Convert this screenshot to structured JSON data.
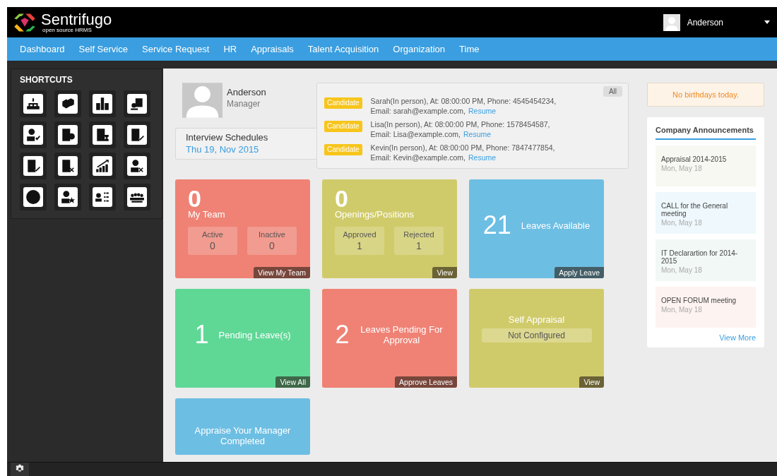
{
  "header": {
    "brand": "Sentrifugo",
    "tagline": "open source HRMS",
    "user": "Anderson"
  },
  "nav": [
    "Dashboard",
    "Self Service",
    "Service Request",
    "HR",
    "Appraisals",
    "Talent Acquisition",
    "Organization",
    "Time"
  ],
  "shortcuts": {
    "title": "SHORTCUTS"
  },
  "profile": {
    "name": "Anderson",
    "role": "Manager"
  },
  "interviews": {
    "title": "Interview Schedules",
    "date": "Thu 19, Nov 2015",
    "filter": "All",
    "items": [
      {
        "badge": "Candidate",
        "line1": "Sarah(In person),  At: 08:00:00 PM, Phone: 4545454234,",
        "email": "Email: sarah@example.com,",
        "link": "Resume"
      },
      {
        "badge": "Candidate",
        "line1": "Lisa(In person),  At: 08:00:00 PM, Phone: 1578454587,",
        "email": "Email: Lisa@example.com,",
        "link": "Resume"
      },
      {
        "badge": "Candidate",
        "line1": "Kevin(In person),  At: 08:00:00 PM, Phone: 7847477854,",
        "email": "Email: Kevin@example.com,",
        "link": "Resume"
      }
    ]
  },
  "tiles": [
    {
      "kind": "stats",
      "color": "#ef8275",
      "number": "0",
      "label": "My Team",
      "stats": [
        {
          "label": "Active",
          "value": "0"
        },
        {
          "label": "Inactive",
          "value": "0"
        }
      ],
      "action": "View My Team"
    },
    {
      "kind": "stats",
      "color": "#d0cb6a",
      "number": "0",
      "label": "Openings/Positions",
      "stats": [
        {
          "label": "Approved",
          "value": "1"
        },
        {
          "label": "Rejected",
          "value": "1"
        }
      ],
      "action": "View"
    },
    {
      "kind": "count",
      "color": "#6dbee3",
      "number": "21",
      "label": "Leaves Available",
      "action": "Apply Leave"
    },
    {
      "kind": "count",
      "color": "#5fd896",
      "number": "1",
      "label": "Pending Leave(s)",
      "action": "View All"
    },
    {
      "kind": "count",
      "color": "#ef8275",
      "number": "2",
      "label": "Leaves Pending For Approval",
      "action": "Approve Leaves"
    },
    {
      "kind": "status",
      "color": "#d0cb6a",
      "title": "Self Appraisal",
      "status": "Not Configured",
      "action": "View"
    },
    {
      "kind": "message",
      "color": "#6dbee3",
      "text": "Appraise Your Manager Completed"
    }
  ],
  "birthdays": "No birthdays today.",
  "announcements": {
    "title": "Company Announcements",
    "items": [
      {
        "title": "Appraisal 2014-2015",
        "date": "Mon, May 18",
        "color": "#f8f8f2"
      },
      {
        "title": "CALL for the General meeting",
        "date": "Mon, May 18",
        "color": "#eef8fd"
      },
      {
        "title": "IT Declarartion for 2014-2015",
        "date": "Mon, May 18",
        "color": "#f1f8f5"
      },
      {
        "title": "OPEN FORUM meeting",
        "date": "Mon, May 18",
        "color": "#fdf3f1"
      }
    ],
    "more": "View More"
  }
}
